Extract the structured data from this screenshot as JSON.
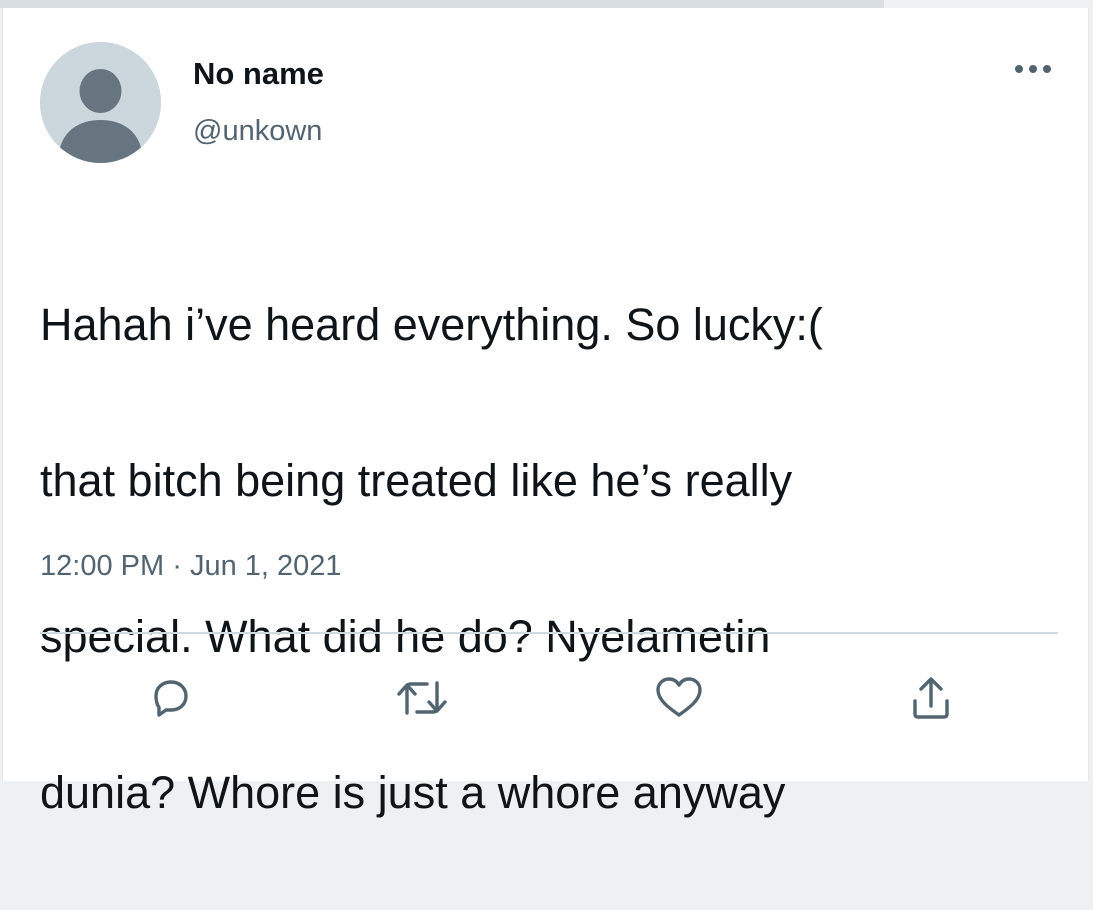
{
  "user": {
    "display_name": "No name",
    "handle": "@unkown"
  },
  "tweet": {
    "lines": [
      "Hahah i’ve heard everything. So lucky:(",
      "that bitch being treated like he’s really",
      "special. What did he do? Nyelametin",
      "dunia? Whore is just a whore anyway"
    ],
    "time": "12:00 PM",
    "separator": "·",
    "date": "Jun 1, 2021"
  },
  "icons": {
    "avatar": "default-avatar-silhouette",
    "more": "more-horizontal-icon",
    "reply": "reply-icon",
    "retweet": "retweet-icon",
    "like": "heart-icon",
    "share": "share-icon"
  },
  "colors": {
    "text_primary": "#0f1419",
    "text_secondary": "#536471",
    "avatar_bg": "#ccd6dd",
    "avatar_fg": "#66757f"
  }
}
